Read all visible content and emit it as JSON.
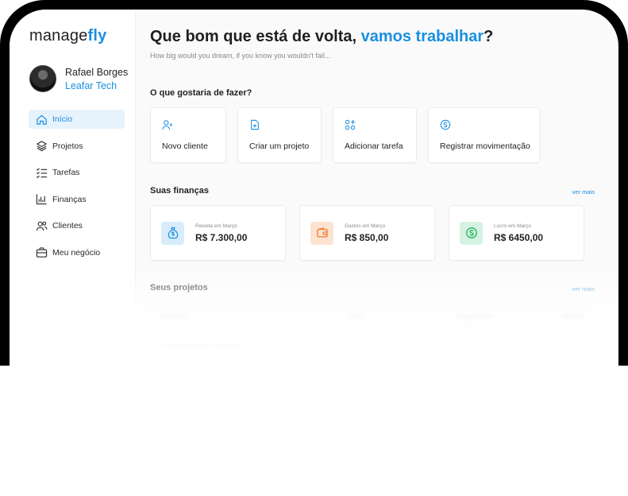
{
  "app": {
    "logo_text": "manage",
    "logo_accent": "fly"
  },
  "profile": {
    "name": "Rafael Borges",
    "company": "Leafar Tech"
  },
  "nav": {
    "items": [
      {
        "label": "Início",
        "icon": "home-icon",
        "active": true
      },
      {
        "label": "Projetos",
        "icon": "layers-icon"
      },
      {
        "label": "Tarefas",
        "icon": "checklist-icon"
      },
      {
        "label": "Finanças",
        "icon": "chart-icon"
      },
      {
        "label": "Clientes",
        "icon": "users-icon"
      },
      {
        "label": "Meu negócio",
        "icon": "briefcase-icon"
      }
    ]
  },
  "header": {
    "greeting": "Que bom que está de volta, ",
    "greeting_accent": "vamos trabalhar",
    "greeting_end": "?",
    "subtitle": "How big would you dream, if you know you wouldn't fail..."
  },
  "actions": {
    "title": "O que gostaria de fazer?",
    "items": [
      {
        "label": "Novo cliente",
        "icon": "user-plus-icon"
      },
      {
        "label": "Criar um projeto",
        "icon": "file-plus-icon"
      },
      {
        "label": "Adicionar tarefa",
        "icon": "grid-plus-icon"
      },
      {
        "label": "Registrar movimentação",
        "icon": "dollar-circle-icon"
      }
    ]
  },
  "finances": {
    "title": "Suas finanças",
    "see_more": "ver mais",
    "cards": [
      {
        "label": "Receita em Março",
        "value": "R$ 7.300,00",
        "icon": "money-bag-icon",
        "color": "#1a8fe0",
        "bg": "#d8ecfb"
      },
      {
        "label": "Gastos em Março",
        "value": "R$ 850,00",
        "icon": "wallet-icon",
        "color": "#f07a2a",
        "bg": "#fde3d2"
      },
      {
        "label": "Lucro em Março",
        "value": "R$ 6450,00",
        "icon": "dollar-circle-icon",
        "color": "#23b05b",
        "bg": "#d6f3e2"
      }
    ]
  },
  "projects": {
    "title": "Seus projetos",
    "see_more": "ver mais",
    "columns": [
      "Projeto",
      "Valor",
      "Progresso",
      "Status"
    ],
    "first_row": "Website para empresa"
  },
  "colors": {
    "accent": "#1a8fe0"
  }
}
